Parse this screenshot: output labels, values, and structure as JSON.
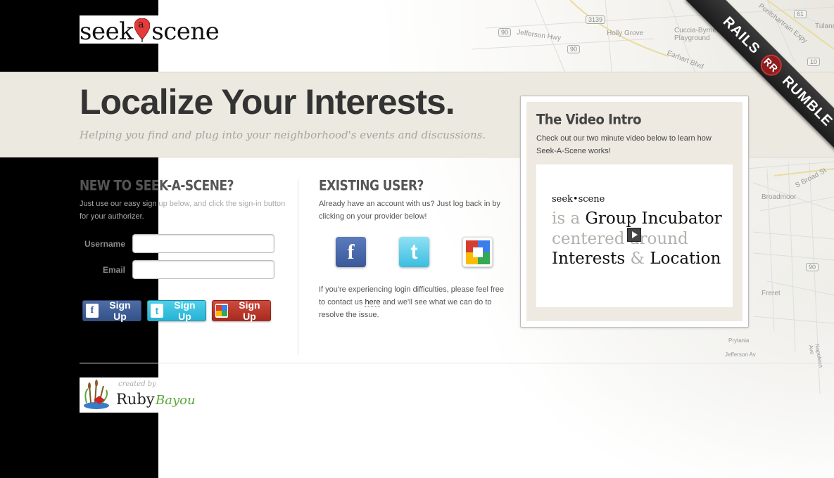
{
  "header": {
    "logo_left": "seek",
    "logo_pin_letter": "a",
    "logo_right": "scene"
  },
  "banner": {
    "title": "Localize Your Interests.",
    "subtitle": "Helping you find and plug into your neighborhood's events and discussions."
  },
  "ribbon": {
    "left": "RAILS",
    "badge": "RR",
    "right": "RUMBLE"
  },
  "map": {
    "labels": [
      "Holly Grove",
      "Cuccia-Byrnes Playground",
      "Jefferson Hwy",
      "Earhart Blvd",
      "Pontchartrain Expy",
      "Tulane",
      "Broadmoor",
      "S Broad St",
      "Freret",
      "Napoleon Ave",
      "Jefferson Av",
      "Prytania"
    ],
    "shields": [
      "3139",
      "90",
      "90",
      "61",
      "10",
      "90"
    ]
  },
  "signup": {
    "heading": "New to Seek-A-Scene?",
    "description": "Just use our easy sign up below, and click the sign-in button for your authorizer.",
    "username_label": "Username",
    "email_label": "Email",
    "buttons": [
      {
        "icon": "f",
        "label": "Sign Up"
      },
      {
        "icon": "t",
        "label": "Sign Up"
      },
      {
        "icon": "g",
        "label": "Sign Up"
      }
    ]
  },
  "login": {
    "heading": "Existing User?",
    "description": "Already have an account with us? Just log back in by clicking on your provider below!",
    "providers": [
      "facebook",
      "twitter",
      "google"
    ],
    "trouble_before": "If you're experiencing login difficulties, please feel free to contact us ",
    "trouble_link": "here",
    "trouble_after": " and we'll see what we can do to resolve the issue."
  },
  "video": {
    "title": "The Video Intro",
    "description": "Check out our two minute video below to learn how Seek-A-Scene works!",
    "logo": "seek•scene",
    "line1_light": "is a ",
    "line1_dark": "Group Incubator",
    "line2_light": "centered around",
    "line3_dark1": "Interests ",
    "line3_light": "& ",
    "line3_dark2": "Location"
  },
  "footer": {
    "created_by": "created by",
    "brand_ruby": "Ruby",
    "brand_bayou": "Bayou"
  },
  "colors": {
    "banner_bg": "#ece9e1",
    "facebook": "#3b5998",
    "twitter": "#29b5d6",
    "google": "#b7352a",
    "bayou_green": "#5aa83a"
  }
}
